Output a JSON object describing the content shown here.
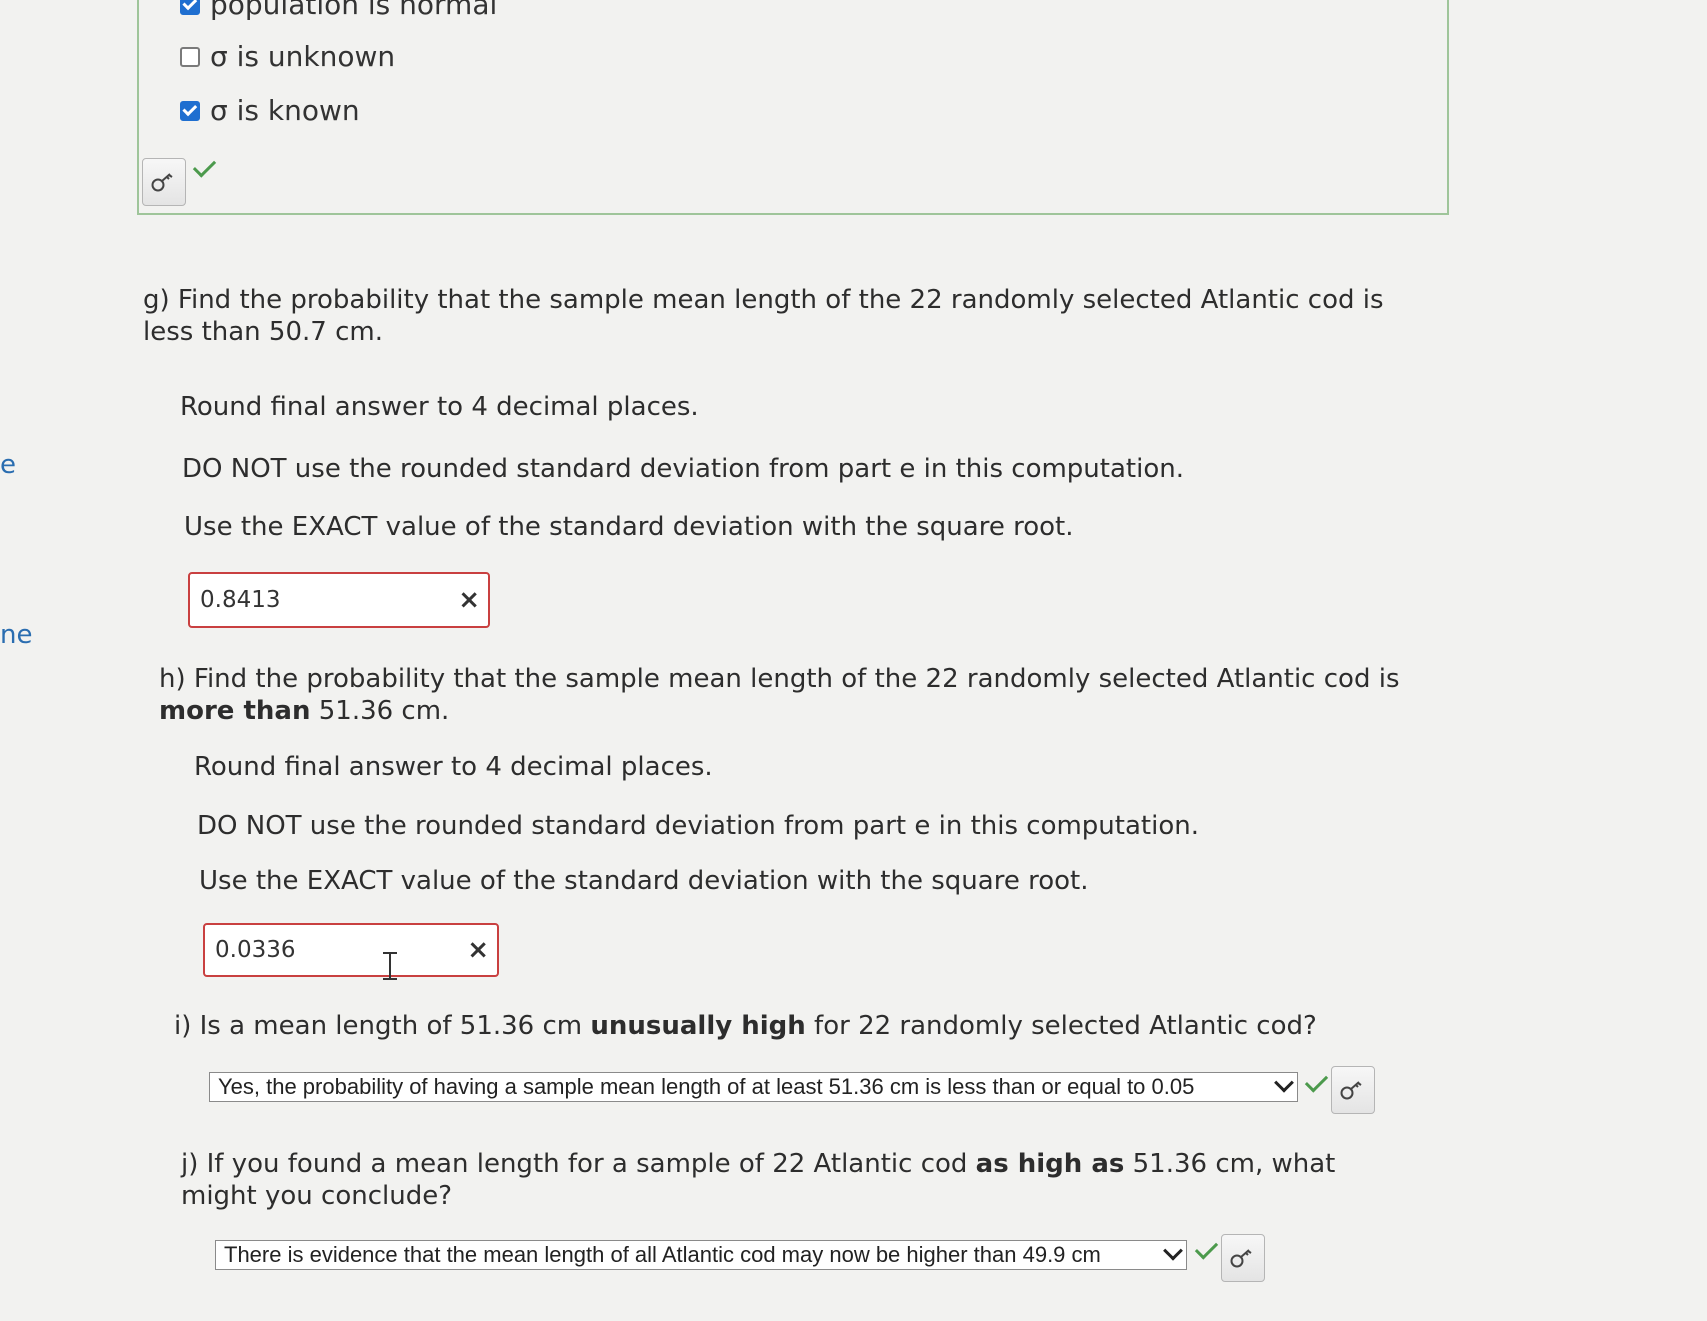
{
  "left_edge": {
    "fragment_1": "e",
    "fragment_2": "ne"
  },
  "prior_part": {
    "options": [
      {
        "label": "population is normal",
        "checked": true
      },
      {
        "label": "σ is unknown",
        "checked": false
      },
      {
        "label": "σ is known",
        "checked": true
      }
    ],
    "key_icon": "key-icon",
    "status": "correct"
  },
  "part_g": {
    "question": "g) Find the probability that the sample mean length of the 22 randomly selected Atlantic cod is less than 50.7 cm.",
    "instructions": [
      "Round final answer to 4 decimal places.",
      "DO NOT use the rounded standard deviation from part e in this computation.",
      "Use the EXACT value of the standard deviation with the square root."
    ],
    "answer": "0.8413",
    "status": "incorrect",
    "status_icon": "×"
  },
  "part_h": {
    "question_pre": "h) Find the probability that the sample mean length of the 22 randomly selected Atlantic cod is ",
    "question_bold": "more than",
    "question_post": " 51.36 cm.",
    "instructions": [
      "Round final answer to 4 decimal places.",
      "DO NOT use the rounded standard deviation from part e in this computation.",
      "Use the EXACT value of the standard deviation with the square root."
    ],
    "answer": "0.0336",
    "status": "incorrect",
    "status_icon": "×"
  },
  "part_i": {
    "question_pre": "i) Is a mean length of 51.36 cm ",
    "question_bold": "unusually high",
    "question_post": " for 22 randomly selected Atlantic cod?",
    "selected": "Yes, the probability of having a sample mean length of at least 51.36 cm is less than or equal to 0.05",
    "status": "correct"
  },
  "part_j": {
    "question_pre": "j) If you found a mean length for a sample of 22 Atlantic cod ",
    "question_bold": "as high as",
    "question_post": " 51.36 cm, what might you conclude?",
    "selected": "There is evidence that the mean length of all Atlantic cod may now be higher than 49.9 cm",
    "status": "correct"
  },
  "colors": {
    "correct": "#4c9a4c",
    "incorrect": "#c94040",
    "checkbox": "#1f6fd0",
    "link": "#2a6db0"
  }
}
